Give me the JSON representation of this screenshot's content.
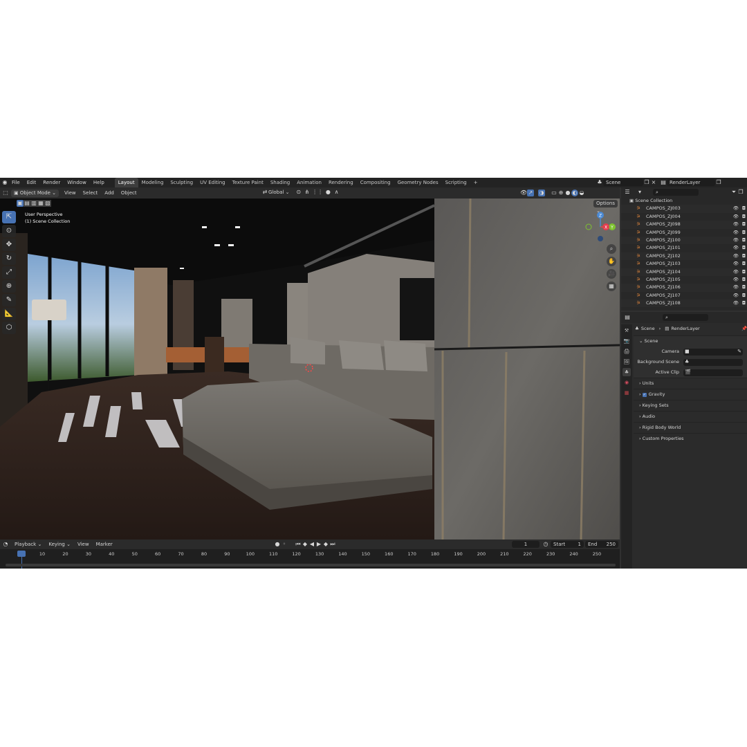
{
  "app": {
    "menu": [
      "File",
      "Edit",
      "Render",
      "Window",
      "Help"
    ],
    "workspaces": [
      "Layout",
      "Modeling",
      "Sculpting",
      "UV Editing",
      "Texture Paint",
      "Shading",
      "Animation",
      "Rendering",
      "Compositing",
      "Geometry Nodes",
      "Scripting"
    ],
    "active_workspace": "Layout",
    "add_tab_label": "+",
    "scene_name": "Scene",
    "view_layer": "RenderLayer"
  },
  "viewport": {
    "mode": "Object Mode",
    "menus": [
      "View",
      "Select",
      "Add",
      "Object"
    ],
    "transform_orientation": "Global",
    "options_label": "Options",
    "overlay_line1": "User Perspective",
    "overlay_line2": "(1) Scene Collection",
    "gizmo_axes": {
      "z": "Z",
      "y": "Y",
      "x": "X"
    },
    "colors": {
      "x_axis": "#e33d4e",
      "y_axis": "#7ec230",
      "z_axis": "#4b8ad4",
      "active_tool": "#4772b3"
    }
  },
  "timeline": {
    "menus": [
      "Playback",
      "Keying",
      "View",
      "Marker"
    ],
    "current_frame": "1",
    "start_label": "Start",
    "start": "1",
    "end_label": "End",
    "end": "250",
    "ticks": [
      "1",
      "10",
      "20",
      "30",
      "40",
      "50",
      "60",
      "70",
      "80",
      "90",
      "100",
      "110",
      "120",
      "130",
      "140",
      "150",
      "160",
      "170",
      "180",
      "190",
      "200",
      "210",
      "220",
      "230",
      "240",
      "250"
    ]
  },
  "outliner": {
    "root": "Scene Collection",
    "items": [
      "CAMPOS_ZJ003",
      "CAMPOS_ZJ004",
      "CAMPOS_ZJ098",
      "CAMPOS_ZJ099",
      "CAMPOS_ZJ100",
      "CAMPOS_ZJ101",
      "CAMPOS_ZJ102",
      "CAMPOS_ZJ103",
      "CAMPOS_ZJ104",
      "CAMPOS_ZJ105",
      "CAMPOS_ZJ106",
      "CAMPOS_ZJ107",
      "CAMPOS_ZJ108"
    ]
  },
  "properties": {
    "breadcrumb_scene": "Scene",
    "breadcrumb_layer": "RenderLayer",
    "section": "Scene",
    "camera_label": "Camera",
    "background_label": "Background Scene",
    "clip_label": "Active Clip",
    "panels": [
      "Units",
      "Gravity",
      "Keying Sets",
      "Audio",
      "Rigid Body World",
      "Custom Properties"
    ],
    "gravity_checked": true
  }
}
